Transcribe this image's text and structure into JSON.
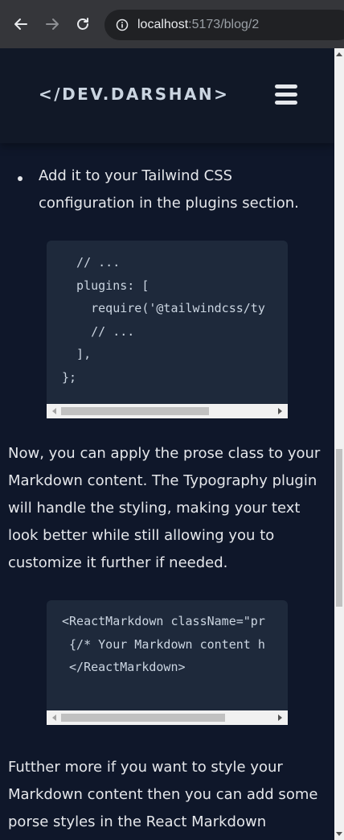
{
  "browser": {
    "url_host": "localhost",
    "url_path": ":5173/blog/2",
    "icons": [
      "back-arrow-icon",
      "forward-arrow-icon",
      "reload-icon",
      "info-icon"
    ]
  },
  "site": {
    "logo": "</DEV.DARSHAN>",
    "menu_icon": "hamburger-menu-icon"
  },
  "article": {
    "bullet_text": "Add it to your Tailwind CSS configuration in the plugins section.",
    "code_block_1": "  // ...\n  plugins: [\n    require('@tailwindcss/ty\n    // ...\n  ],\n};",
    "paragraph_1": "Now, you can apply the prose class to your Markdown content. The Typography plugin will handle the styling, making your text look better while still allowing you to customize it further if needed.",
    "code_block_2": "<ReactMarkdown className=\"pr\n {/* Your Markdown content h\n </ReactMarkdown>",
    "paragraph_2": "Futther more if you want to style your Markdown content then you can add some porse styles in the React Markdown"
  },
  "scroll": {
    "vertical_position_fraction": 0.51
  },
  "colors": {
    "page_bg": "#0f172a",
    "header_bg": "#111827",
    "code_bg": "#1e293b",
    "text": "#e5e7eb"
  }
}
